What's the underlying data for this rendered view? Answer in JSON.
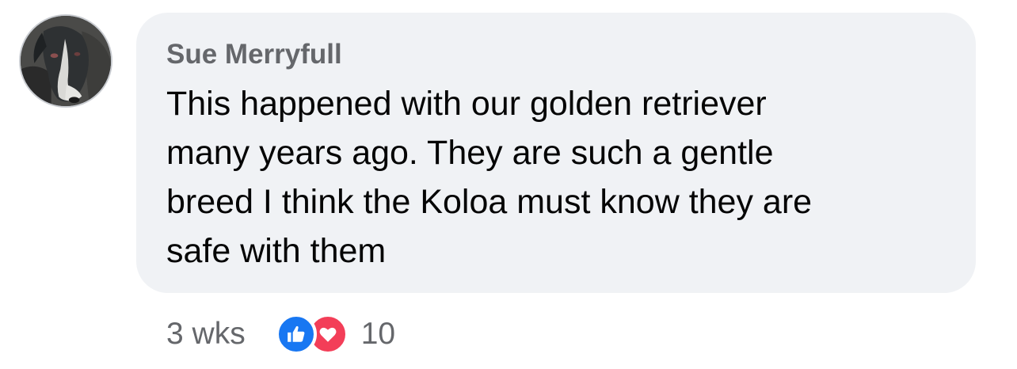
{
  "comment": {
    "author": "Sue Merryfull",
    "text": "This happened with our golden retriever\nmany years ago. They are such a gentle\nbreed I think the Koloa must know they are\nsafe with them",
    "timestamp": "3 wks",
    "reactions": {
      "icons": [
        "like-icon",
        "love-icon"
      ],
      "count": "10"
    }
  },
  "colors": {
    "bubble_background": "#f0f2f5",
    "author_text": "#65676b",
    "body_text": "#050505",
    "like_blue": "#1877f2",
    "love_red": "#f33e58"
  }
}
